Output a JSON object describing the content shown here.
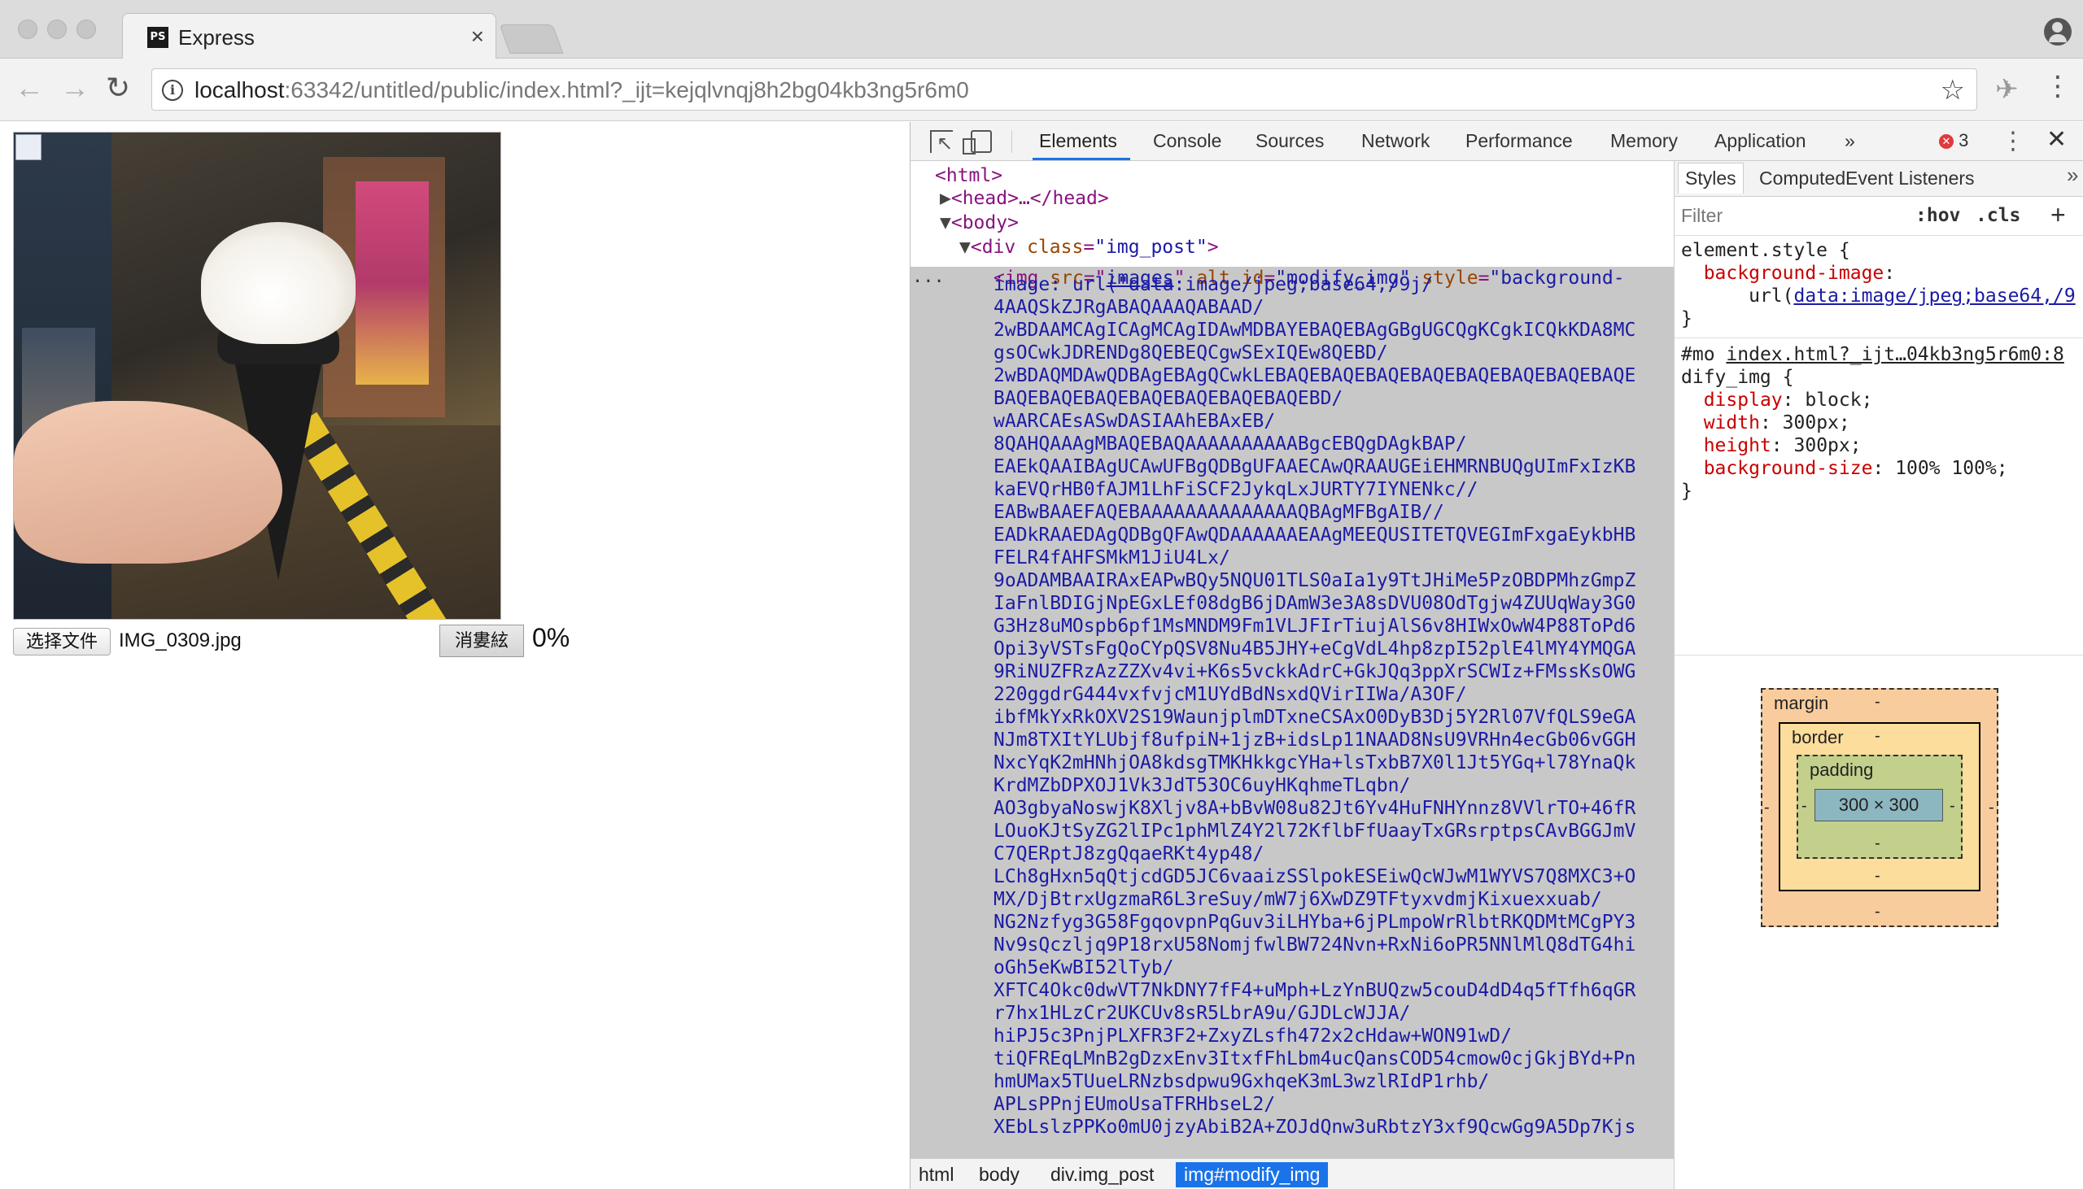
{
  "browser": {
    "tab_title": "Express",
    "tab_favicon": "PS",
    "tab_close": "×",
    "url_host": "localhost",
    "url_rest": ":63342/untitled/public/index.html?_ijt=kejqlvnqj8h2bg04kb3ng5r6m0"
  },
  "page": {
    "file_button": "选择文件",
    "file_name": "IMG_0309.jpg",
    "cancel_button": "消婁絃",
    "progress": "0%"
  },
  "devtools": {
    "tabs": [
      "Elements",
      "Console",
      "Sources",
      "Network",
      "Performance",
      "Memory",
      "Application"
    ],
    "more": "»",
    "error_count": "3",
    "elements_tree": {
      "html": "<html>",
      "head": "<head>…</head>",
      "body": "<body>",
      "div_open": "<div",
      "div_attr": "class",
      "div_val": "\"img_post\"",
      "ellipsis": "...",
      "img_open": "<img",
      "img_src_attr": "src",
      "img_src_val": "images",
      "img_alt_attr": "alt",
      "img_id_attr": "id",
      "img_id_val": "\"modify_img\"",
      "img_style_attr": "style",
      "img_style_start": "\"background-",
      "base64_lines": [
        "image: url(\"data:image/jpeg;base64,/9j/",
        "4AAQSkZJRgABAQAAAQABAAD/",
        "2wBDAAMCAgICAgMCAgIDAwMDBAYEBAQEBAgGBgUGCQgKCgkICQkKDA8MC",
        "gsOCwkJDRENDg8QEBEQCgwSExIQEw8QEBD/",
        "2wBDAQMDAwQDBAgEBAgQCwkLEBAQEBAQEBAQEBAQEBAQEBAQEBAQEBAQE",
        "BAQEBAQEBAQEBAQEBAQEBAQEBAQEBD/",
        "wAARCAEsASwDASIAAhEBAxEB/",
        "8QAHQAAAgMBAQEBAQAAAAAAAAAABgcEBQgDAgkBAP/",
        "EAEkQAAIBAgUCAwUFBgQDBgUFAAECAwQRAAUGEiEHMRNBUQgUImFxIzKB",
        "kaEVQrHB0fAJM1LhFiSCF2JykqLxJURTY7IYNENkc//",
        "EABwBAAEFAQEBAAAAAAAAAAAAAAQBAgMFBgAIB//",
        "EADkRAAEDAgQDBgQFAwQDAAAAAAEAAgMEEQUSITETQVEGImFxgaEykbHB",
        "FELR4fAHFSMkM1JiU4Lx/",
        "9oADAMBAAIRAxEAPwBQy5NQU01TLS0aIa1y9TtJHiMe5PzOBDPMhzGmpZ",
        "IaFnlBDIGjNpEGxLEf08dgB6jDAmW3e3A8sDVU08OdTgjw4ZUUqWay3G0",
        "G3Hz8uMOspb6pf1MsMNDM9Fm1VLJFIrTiujAlS6v8HIWxOwW4P88ToPd6",
        "Opi3yVSTsFgQoCYpQSV8Nu4B5JHY+eCgVdL4hp8zpI52plE4lMY4YMQGA",
        "9RiNUZFRzAzZZXv4vi+K6s5vckkAdrC+GkJQq3ppXrSCWIz+FMssKsOWG",
        "220ggdrG444vxfvjcM1UYdBdNsxdQVirIIWa/A3OF/",
        "ibfMkYxRkOXV2S19WaunjplmDTxneCSAxO0DyB3Dj5Y2Rl07VfQLS9eGA",
        "NJm8TXItYLUbjf8ufpiN+1jzB+idsLp11NAAD8NsU9VRHn4ecGb06vGGH",
        "NxcYqK2mHNhjOA8kdsgTMKHkkgcYHa+lsTxbB7X0l1Jt5YGq+l78YnaQk",
        "KrdMZbDPXOJ1Vk3JdT53OC6uyHKqhmeTLqbn/",
        "AO3gbyaNoswjK8Xljv8A+bBvW08u82Jt6Yv4HuFNHYnnz8VVlrTO+46fR",
        "LOuoKJtSyZG2lIPc1phMlZ4Y2l72KflbFfUaayTxGRsrptpsCAvBGGJmV",
        "C7QERptJ8zgQqaeRKt4yp48/",
        "LCh8gHxn5qQtjcdGD5JC6vaaizSSlpokESEiwQcWJwM1WYVS7Q8MXC3+O",
        "MX/DjBtrxUgzmaR6L3reSuy/mW7j6XwDZ9TFtyxvdmjKixuexxuab/",
        "NG2Nzfyg3G58FgqovpnPqGuv3iLHYba+6jPLmpoWrRlbtRKQDMtMCgPY3",
        "Nv9sQczljq9P18rxU58NomjfwlBW724Nvn+RxNi6oPR5NNlMlQ8dTG4hi",
        "oGh5eKwBI52lTyb/",
        "XFTC4Okc0dwVT7NkDNY7fF4+uMph+LzYnBUQzw5couD4dD4q5fTfh6qGR",
        "r7hx1HLzCr2UKCUv8sR5LbrA9u/GJDLcWJJA/",
        "hiPJ5c3PnjPLXFR3F2+ZxyZLsfh472x2cHdaw+WON91wD/",
        "tiQFREqLMnB2gDzxEnv3ItxfFhLbm4ucQansCOD54cmow0cjGkjBYd+Pn",
        "hmUMax5TUueLRNzbsdpwu9GxhqeK3mL3wzlRIdP1rhb/",
        "APLsPPnjEUmoUsaTFRHbseL2/",
        "XEbLslzPPKo0mU0jzyAbiB2A+ZOJdQnw3uRbtzY3xf9QcwGg9A5Dp7Kjs"
      ]
    },
    "breadcrumbs": [
      "html",
      "body",
      "div.img_post",
      "img#modify_img"
    ],
    "styles_tabs": [
      "Styles",
      "Computed",
      "Event Listeners"
    ],
    "filter_placeholder": "Filter",
    "hov": ":hov",
    "cls": ".cls",
    "plus": "+",
    "rules": {
      "element_style_selector": "element.style {",
      "bg_prop": "background-image",
      "bg_value_prefix": "url(",
      "bg_value_link": "data:image/jpeg;base64,/9",
      "close": "}",
      "mo_selector": "#mo",
      "mo_source": "index.html?_ijt…04kb3ng5r6m0:8",
      "mo_selector_rest": "dify_img {",
      "decls": [
        {
          "prop": "display",
          "value": "block;"
        },
        {
          "prop": "width",
          "value": "300px;"
        },
        {
          "prop": "height",
          "value": "300px;"
        },
        {
          "prop": "background-size",
          "value": "100% 100%;"
        }
      ]
    },
    "box_model": {
      "margin_label": "margin",
      "border_label": "border",
      "padding_label": "padding",
      "content": "300 × 300",
      "dash": "-"
    }
  }
}
